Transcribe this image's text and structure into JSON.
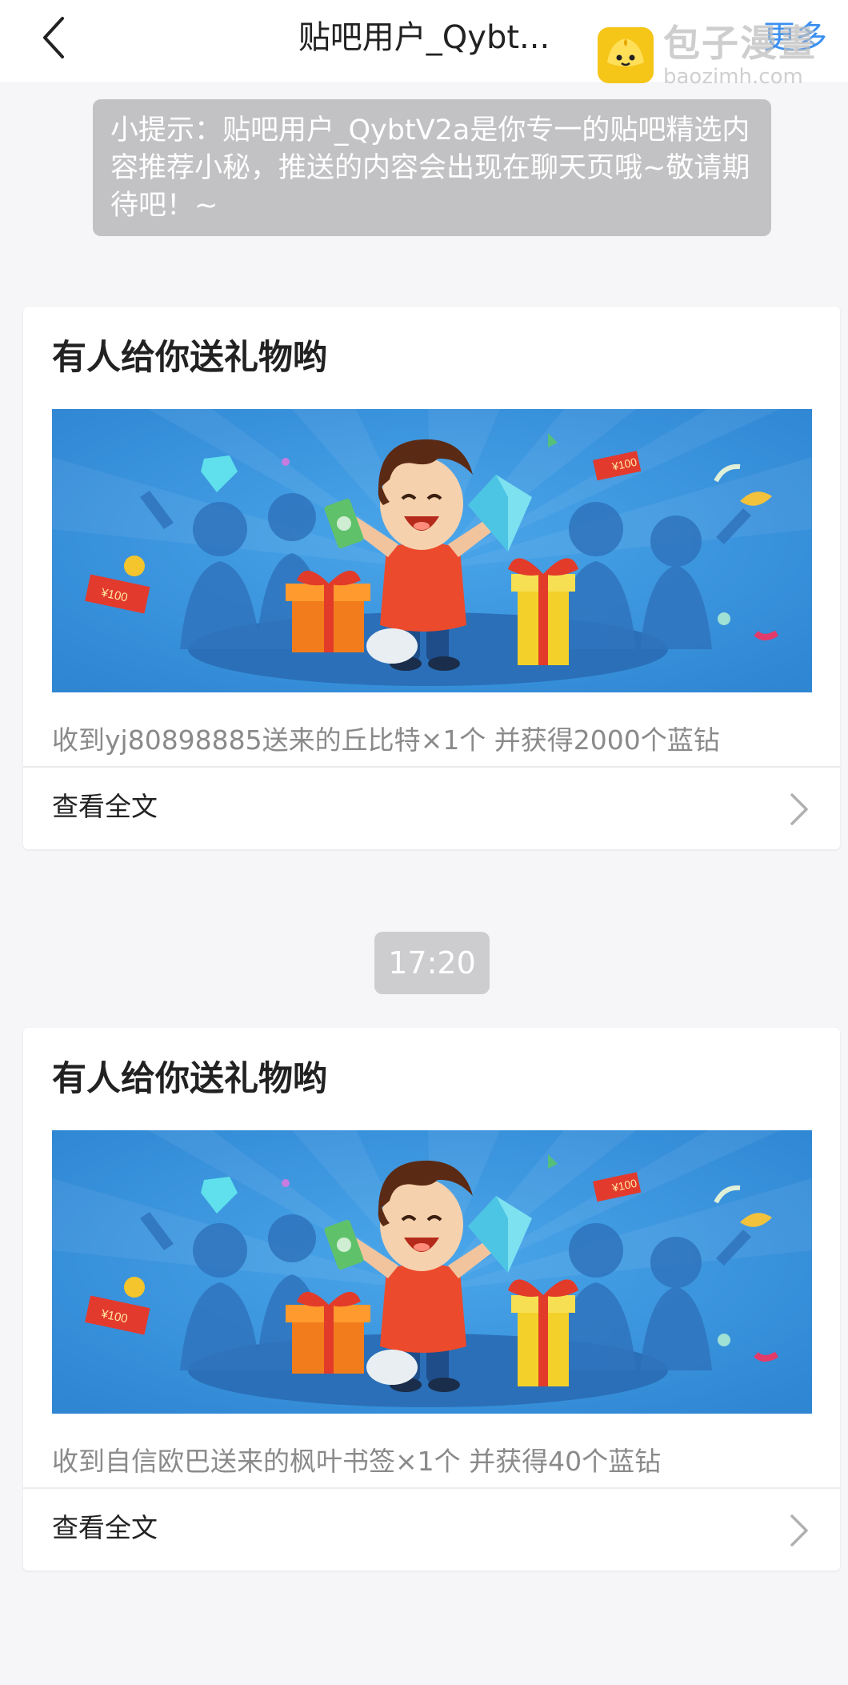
{
  "header": {
    "back_icon": "chevron-left-icon",
    "title": "贴吧用户_Qybt...",
    "more_label": "更多"
  },
  "watermark": {
    "brand": "包子漫畫",
    "domain": "baozimh.com"
  },
  "tip": {
    "text": "小提示：贴吧用户_QybtV2a是你专一的贴吧精选内容推荐小秘，推送的内容会出现在聊天页哦~敬请期待吧！~"
  },
  "messages": [
    {
      "title": "有人给你送礼物哟",
      "description": "收到yj80898885送来的丘比特×1个 并获得2000个蓝钻",
      "read_more": "查看全文"
    },
    {
      "title": "有人给你送礼物哟",
      "description": "收到自信欧巴送来的枫叶书签×1个 并获得40个蓝钻",
      "read_more": "查看全文"
    }
  ],
  "timestamp": "17:20",
  "banner": {
    "red_envelope_label": "¥100"
  },
  "colors": {
    "accent": "#3b8ff0",
    "banner_blue": "#3f97dd",
    "tip_bg": "#c2c2c4"
  }
}
